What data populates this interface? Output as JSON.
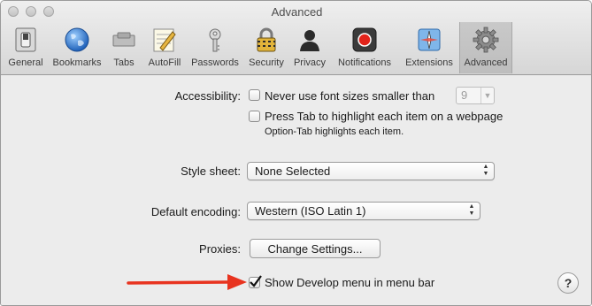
{
  "window": {
    "title": "Advanced",
    "traffic_lights": [
      "close",
      "minimize",
      "zoom"
    ]
  },
  "toolbar": {
    "active": "Advanced",
    "items": [
      {
        "label": "General",
        "icon": "general-switch-icon"
      },
      {
        "label": "Bookmarks",
        "icon": "globe-icon"
      },
      {
        "label": "Tabs",
        "icon": "tabs-icon"
      },
      {
        "label": "AutoFill",
        "icon": "autofill-pencil-icon"
      },
      {
        "label": "Passwords",
        "icon": "key-icon"
      },
      {
        "label": "Security",
        "icon": "padlock-icon"
      },
      {
        "label": "Privacy",
        "icon": "person-silhouette-icon"
      },
      {
        "label": "Notifications",
        "icon": "notification-record-icon"
      },
      {
        "label": "Extensions",
        "icon": "puzzle-compass-icon"
      },
      {
        "label": "Advanced",
        "icon": "gear-icon"
      }
    ]
  },
  "accessibility": {
    "label": "Accessibility:",
    "font_size_checkbox": "Never use font sizes smaller than",
    "font_size_checked": false,
    "font_size_value": "9",
    "tab_checkbox": "Press Tab to highlight each item on a webpage",
    "tab_checked": false,
    "tab_hint": "Option-Tab highlights each item."
  },
  "style_sheet": {
    "label": "Style sheet:",
    "value": "None Selected"
  },
  "encoding": {
    "label": "Default encoding:",
    "value": "Western (ISO Latin 1)"
  },
  "proxies": {
    "label": "Proxies:",
    "button": "Change Settings..."
  },
  "develop": {
    "label": "Show Develop menu in menu bar",
    "checked": true
  },
  "help": {
    "label": "?"
  },
  "colors": {
    "arrow": "#e8331f",
    "window_bg": "#ececec",
    "active_tab_bg": "#c4c4c4"
  }
}
